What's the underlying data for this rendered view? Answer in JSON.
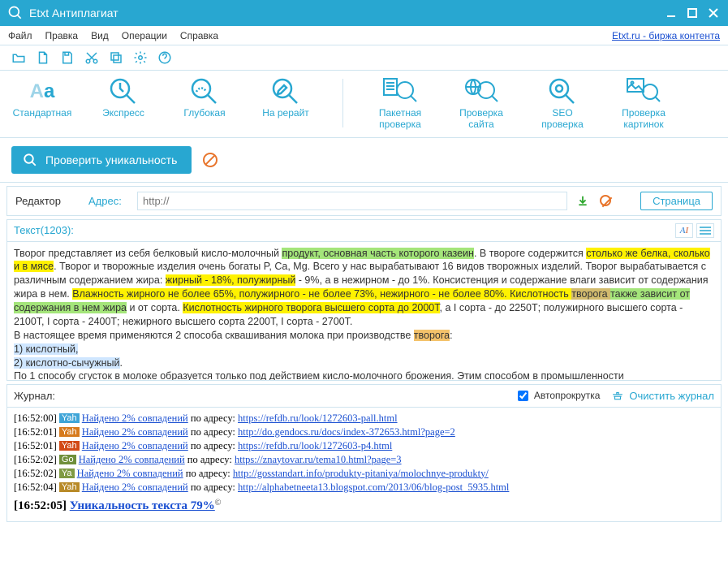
{
  "app": {
    "title": "Etxt Антиплагиат"
  },
  "menubar": {
    "items": [
      "Файл",
      "Правка",
      "Вид",
      "Операции",
      "Справка"
    ],
    "link": "Etxt.ru - биржа контента"
  },
  "actions": {
    "standard": "Стандартная",
    "express": "Экспресс",
    "deep": "Глубокая",
    "rewrite": "На рерайт",
    "batch": "Пакетная\nпроверка",
    "site": "Проверка\nсайта",
    "seo": "SEO\nпроверка",
    "images": "Проверка\nкартинок"
  },
  "checkrow": {
    "run": "Проверить уникальность"
  },
  "workspace": {
    "editor": "Редактор",
    "address_label": "Адрес:",
    "address_placeholder": "http://",
    "page_tab": "Страница"
  },
  "textpanel": {
    "title": "Текст(1203):",
    "body": {
      "p1a": "Творог представляет из себя белковый кисло-молочный ",
      "p1b": "продукт, основная часть которого казеин",
      "p1c": ". В твороге содержится ",
      "p1d": "столько же белка, сколько и в мясе",
      "p1e": ". Творог и творожные изделия очень богаты P, Ca, Mg. Всего у нас вырабатывают 16 видов творожных изделий. Творог вырабатывается с различным содержанием жира: ",
      "p1f": "жирный - 18%, полужирный",
      "p1g": " - 9%, а в нежирном - до 1%. Консистенция и содержание влаги зависит от содержания жира в нем. ",
      "p1h": "Влажность жирного не более 65%, полужирного - не более 73%, нежирного - не более 80%. Кислотность ",
      "p1ha": "творога ",
      "p1hb": "также зависит от содержания в нем жира",
      "p1i": " и от сорта. ",
      "p1j": "Кислотность жирного творога высшего сорта до 2000Т",
      "p1k": ", а I сорта - до 2250Т; полужирного высшего сорта - 2100Т, I сорта - 2400Т; нежирного высшего сорта 2200Т, I сорта - 2700Т.",
      "p2a": "В настоящее время применяются 2 способа сквашивания молока при производстве ",
      "p2b": "творога",
      "p2c": ":",
      "p3": "1) кислотный,",
      "p4": "2) кислотно-сычужный",
      "p4b": ".",
      "p5": "По 1 способу сгусток в молоке образуется только под действием кисло-молочного брожения. Этим способом в промышленности"
    }
  },
  "log": {
    "title": "Журнал:",
    "autoscroll": "Автопрокрутка",
    "clear": "Очистить журнал",
    "found_text": "Найдено 2% совпадений",
    "by_address": " по адресу: ",
    "entries": [
      {
        "ts": "[16:52:00]",
        "badge": "Yah",
        "badge_bg": "#3fa5d8",
        "url": "https://refdb.ru/look/1272603-pall.html"
      },
      {
        "ts": "[16:52:01]",
        "badge": "Yah",
        "badge_bg": "#d67a1d",
        "url": "http://do.gendocs.ru/docs/index-372653.html?page=2"
      },
      {
        "ts": "[16:52:01]",
        "badge": "Yah",
        "badge_bg": "#d24a16",
        "url": "https://refdb.ru/look/1272603-p4.html"
      },
      {
        "ts": "[16:52:02]",
        "badge": "Go",
        "badge_bg": "#6f8f3a",
        "url": "https://znaytovar.ru/tema10.html?page=3"
      },
      {
        "ts": "[16:52:02]",
        "badge": "Ya",
        "badge_bg": "#7f9a43",
        "url": "http://gosstandart.info/produkty-pitaniya/molochnye-produkty/"
      },
      {
        "ts": "[16:52:04]",
        "badge": "Yah",
        "badge_bg": "#b88a28",
        "url": "http://alphabetneeta13.blogspot.com/2013/06/blog-post_5935.html"
      }
    ],
    "result_ts": "[16:52:05] ",
    "result": "Уникальность текста 79%"
  }
}
